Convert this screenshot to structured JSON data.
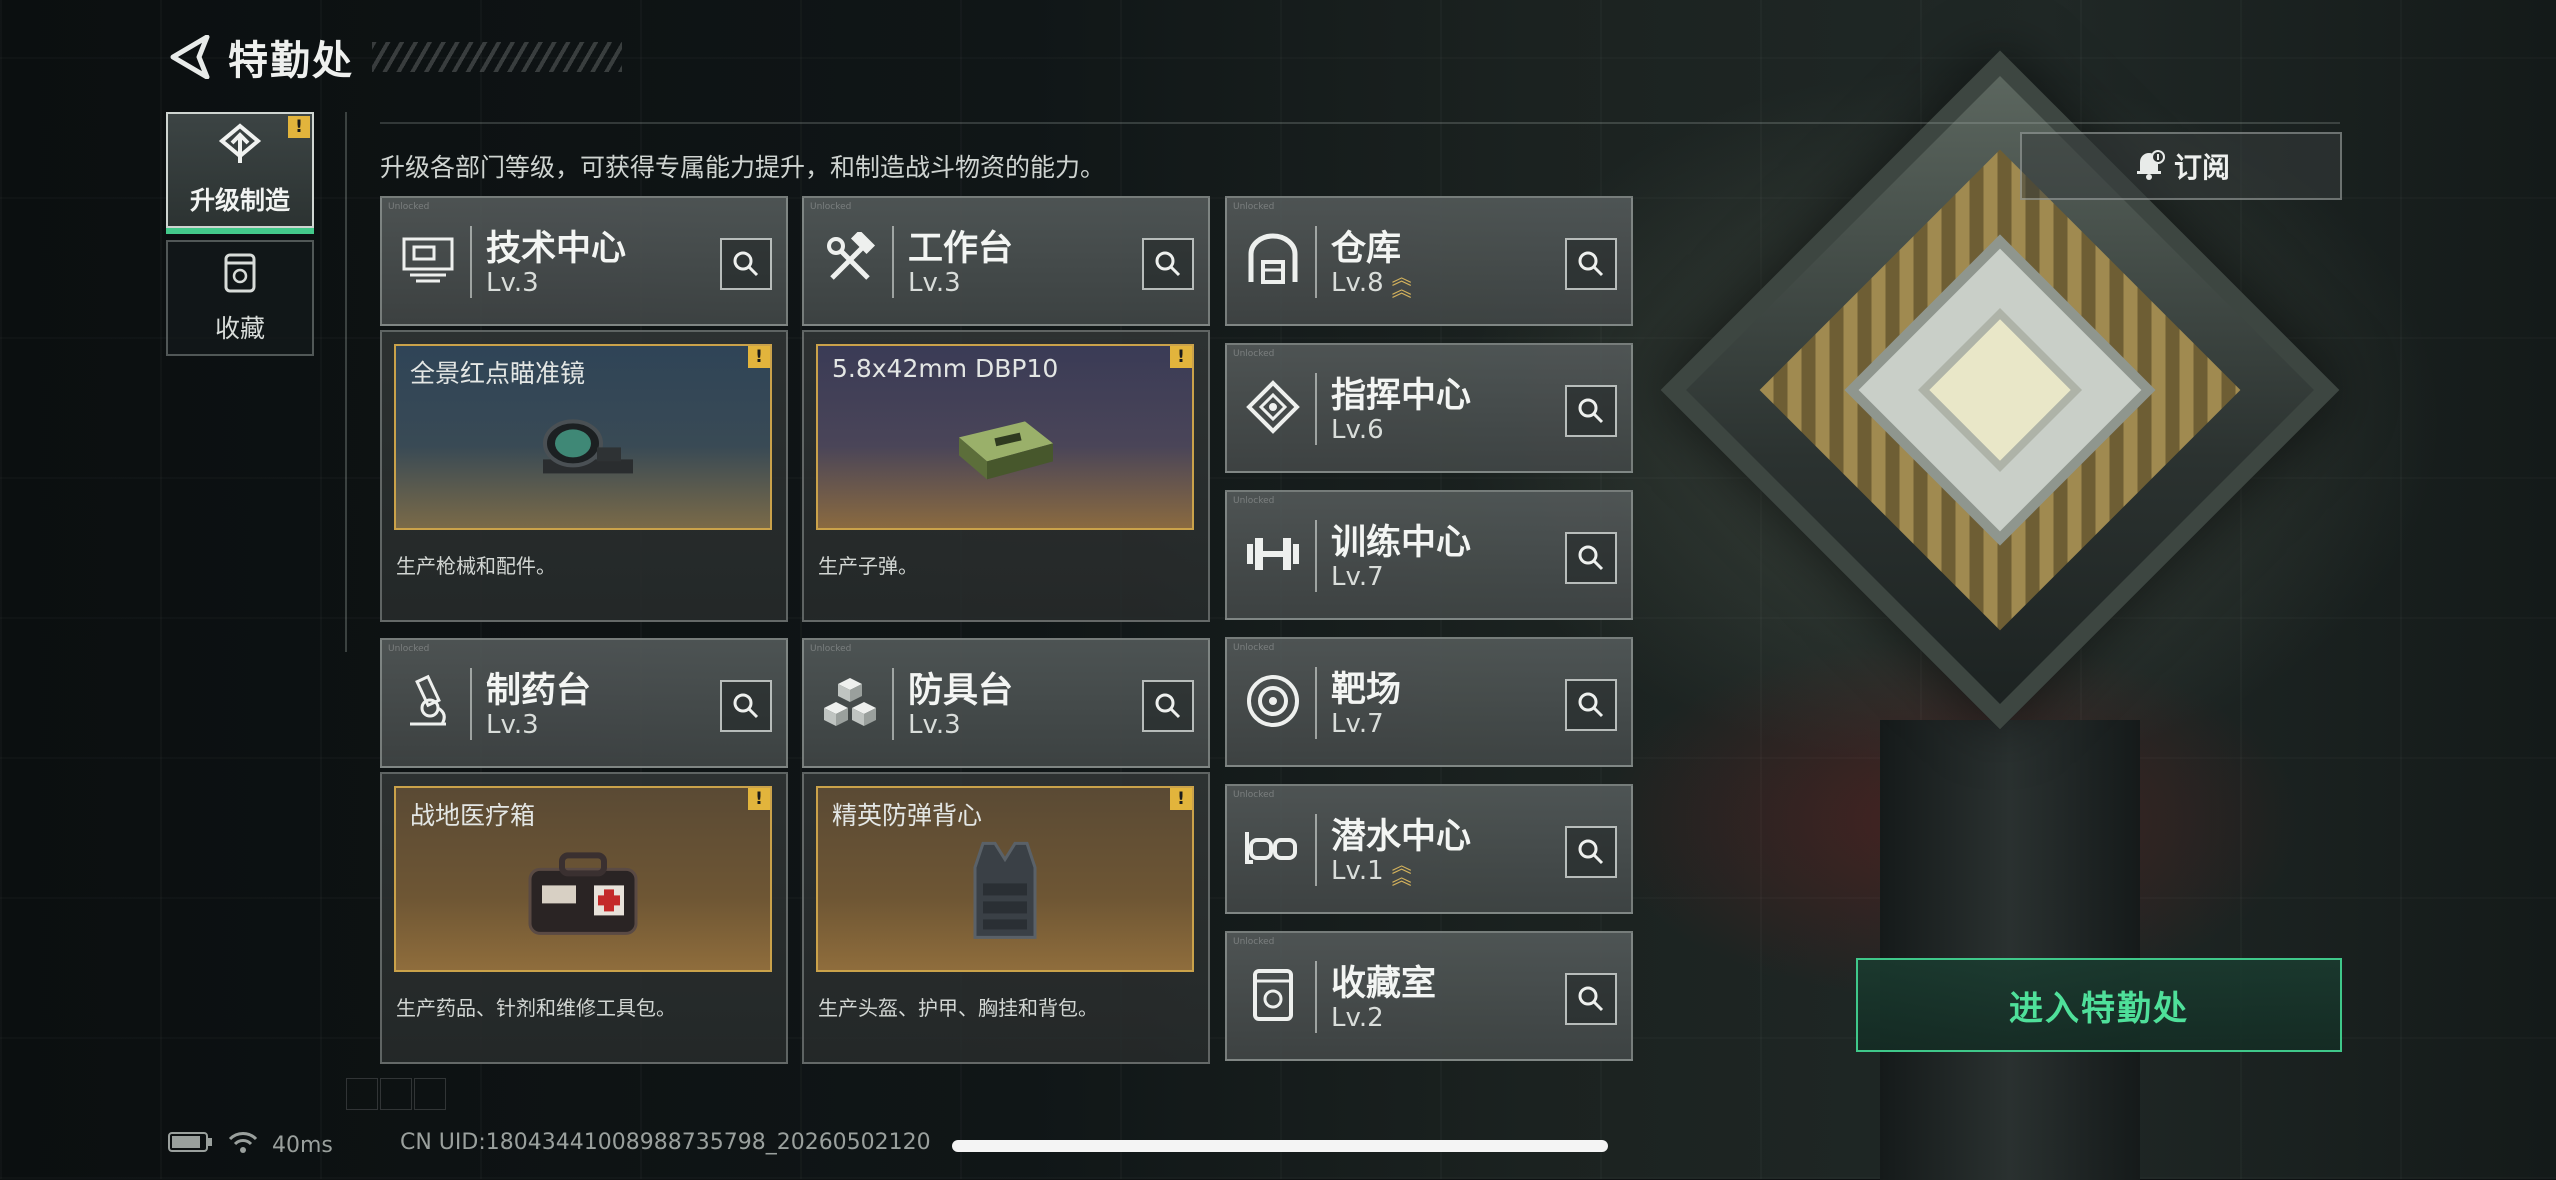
{
  "header": {
    "title": "特勤处"
  },
  "nav": {
    "items": [
      {
        "label": "升级制造",
        "active": true,
        "alert": "!"
      },
      {
        "label": "收藏",
        "active": false
      }
    ]
  },
  "description": "升级各部门等级，可获得专属能力提升，和制造战斗物资的能力。",
  "subscribe_label": "订阅",
  "enter_label": "进入特勤处",
  "departments": {
    "tech": {
      "name": "技术中心",
      "level": "Lv.3"
    },
    "workbench": {
      "name": "工作台",
      "level": "Lv.3"
    },
    "pharmacy": {
      "name": "制药台",
      "level": "Lv.3"
    },
    "armor": {
      "name": "防具台",
      "level": "Lv.3"
    },
    "warehouse": {
      "name": "仓库",
      "level": "Lv.8"
    },
    "command": {
      "name": "指挥中心",
      "level": "Lv.6"
    },
    "training": {
      "name": "训练中心",
      "level": "Lv.7"
    },
    "range": {
      "name": "靶场",
      "level": "Lv.7"
    },
    "diving": {
      "name": "潜水中心",
      "level": "Lv.1"
    },
    "collection": {
      "name": "收藏室",
      "level": "Lv.2"
    }
  },
  "products": {
    "tech": {
      "item": "全景红点瞄准镜",
      "desc": "生产枪械和配件。",
      "alert": "!"
    },
    "workbench": {
      "item": "5.8x42mm DBP10",
      "desc": "生产子弹。",
      "alert": "!"
    },
    "pharmacy": {
      "item": "战地医疗箱",
      "desc": "生产药品、针剂和维修工具包。",
      "alert": "!"
    },
    "armor": {
      "item": "精英防弹背心",
      "desc": "生产头盔、护甲、胸挂和背包。",
      "alert": "!"
    }
  },
  "status": {
    "ping": "40ms",
    "uid": "CN UID:18043441008988735798_20260502120"
  },
  "colors": {
    "accent_green": "#43c98a",
    "alert_yellow": "#e2b43c",
    "frame_gold": "#caa24a"
  }
}
